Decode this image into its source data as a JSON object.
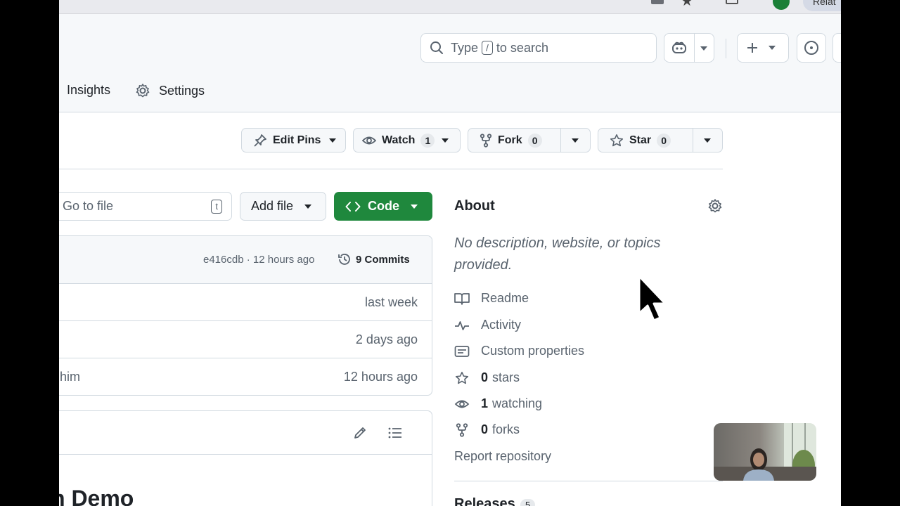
{
  "header": {
    "search_prefix": "Type",
    "search_key": "/",
    "search_suffix": "to search",
    "tabs": [
      {
        "label": "Insights"
      },
      {
        "label": "Settings"
      }
    ]
  },
  "repo_actions": {
    "edit_pins_label": "Edit Pins",
    "watch_label": "Watch",
    "watch_count": "1",
    "fork_label": "Fork",
    "fork_count": "0",
    "star_label": "Star",
    "star_count": "0"
  },
  "file_controls": {
    "goto_file_placeholder": "Go to file",
    "goto_file_key": "t",
    "add_file_label": "Add file",
    "code_label": "Code"
  },
  "latest_commit": {
    "meta": "e416cdb · 12 hours ago",
    "commits_label": "9 Commits"
  },
  "files": [
    {
      "name": "",
      "time": "last week"
    },
    {
      "name": "",
      "time": "2 days ago"
    },
    {
      "name": "him",
      "time": "12 hours ago"
    }
  ],
  "readme": {
    "heading": "n Demo"
  },
  "about": {
    "title": "About",
    "description": "No description, website, or topics provided.",
    "readme_label": "Readme",
    "activity_label": "Activity",
    "custom_properties_label": "Custom properties",
    "stars_count": "0",
    "stars_label": "stars",
    "watching_count": "1",
    "watching_label": "watching",
    "forks_count": "0",
    "forks_label": "forks",
    "report_label": "Report repository",
    "releases_label": "Releases",
    "releases_count": "5"
  },
  "browser": {
    "profile_label": "Relat"
  },
  "colors": {
    "code_button": "#1f883d",
    "border": "#d1d9e0",
    "muted_text": "#59636e",
    "header_bg": "#f6f8fa"
  }
}
